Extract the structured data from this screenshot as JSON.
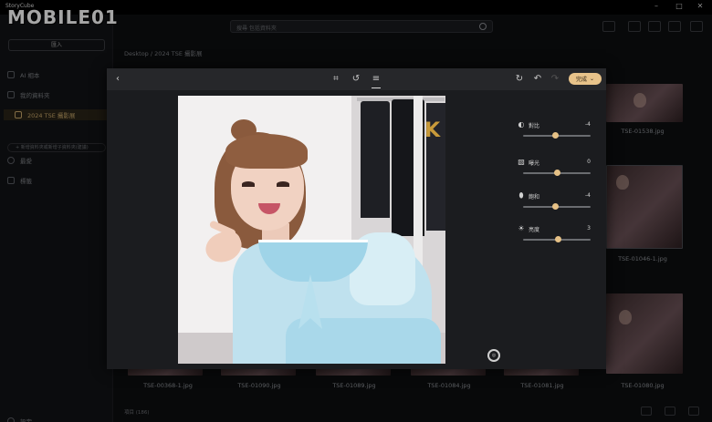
{
  "window": {
    "title": "StoryCube",
    "controls": {
      "minimize": "–",
      "maximize": "□",
      "close": "✕"
    }
  },
  "brand": {
    "logo_text": "MOBILE01"
  },
  "sidebar": {
    "import_label": "匯入",
    "items": [
      {
        "label": "AI 相本",
        "icon": "ai-album-icon"
      },
      {
        "label": "我的資料夾",
        "icon": "folder-icon"
      },
      {
        "label": "2024 TSE 攝影展",
        "icon": "folder-icon"
      }
    ],
    "add_folder_label": "+ 新增資料夾或新增子資料夾(建議)",
    "items2": [
      {
        "label": "最愛",
        "icon": "heart-icon"
      },
      {
        "label": "標籤",
        "icon": "tag-icon"
      }
    ],
    "settings_label": "設定"
  },
  "search": {
    "placeholder": "搜尋 包括資料夾"
  },
  "breadcrumb": "Desktop / 2024 TSE 攝影展",
  "grid": {
    "labels_right": [
      "TSE-01538.jpg",
      "TSE-01046-1.jpg",
      "TSE-01080.jpg"
    ],
    "labels_bottom": [
      "TSE-00368-1.jpg",
      "TSE-01090.jpg",
      "TSE-01089.jpg",
      "TSE-01084.jpg",
      "TSE-01081.jpg"
    ]
  },
  "status": {
    "left": "項目 (186)"
  },
  "editor": {
    "done_label": "完成",
    "adjustments": [
      {
        "label": "對比",
        "value": "-4",
        "level": -0.04,
        "icon": "contrast-icon"
      },
      {
        "label": "曝光",
        "value": "0",
        "level": 0,
        "icon": "exposure-icon"
      },
      {
        "label": "飽和",
        "value": "-4",
        "level": -0.04,
        "icon": "saturation-icon"
      },
      {
        "label": "亮度",
        "value": "3",
        "level": 0.03,
        "icon": "brightness-icon"
      }
    ],
    "photo_text": "JK"
  },
  "colors": {
    "accent": "#e8c38a",
    "bg": "#0d0e10",
    "panel": "#1b1c1f"
  }
}
